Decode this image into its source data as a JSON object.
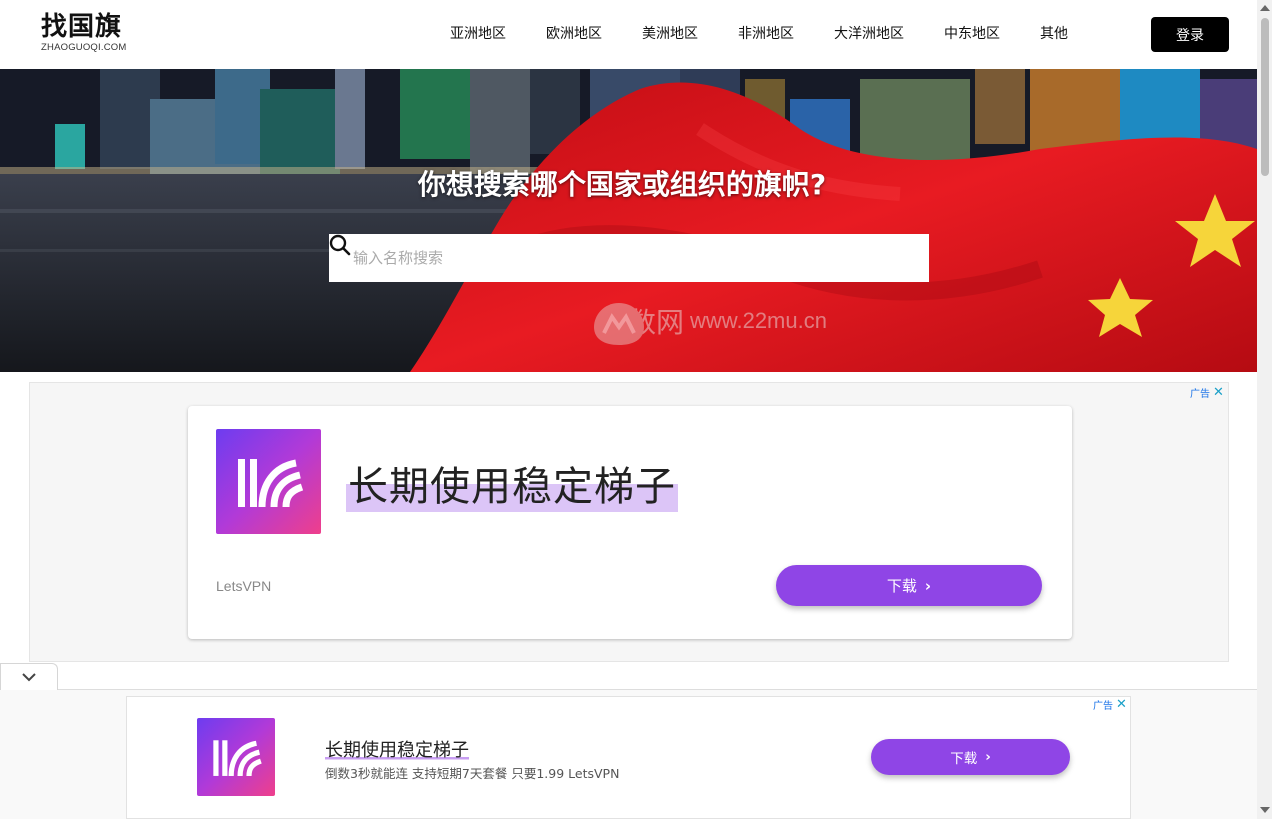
{
  "header": {
    "logo_main": "找国旗",
    "logo_sub": "ZHAOGUOQI.COM",
    "nav": [
      "亚洲地区",
      "欧洲地区",
      "美洲地区",
      "非洲地区",
      "大洋洲地区",
      "中东地区",
      "其他"
    ],
    "login_label": "登录"
  },
  "hero": {
    "title": "你想搜索哪个国家或组织的旗帜?",
    "search_placeholder": "输入名称搜索",
    "search_icon": "search-icon",
    "watermark_text": "慕数网",
    "watermark_url": "www.22mu.cn"
  },
  "ad1": {
    "ad_label": "广告",
    "close_symbol": "✕",
    "headline": "长期使用稳定梯子",
    "brand": "LetsVPN",
    "button_label": "下载",
    "button_chevron": "›"
  },
  "ad2": {
    "ad_label": "广告",
    "close_symbol": "✕",
    "headline": "长期使用稳定梯子",
    "description": "倒数3秒就能连 支持短期7天套餐 只要1.99 LetsVPN",
    "button_label": "下载",
    "button_chevron": "›"
  },
  "colors": {
    "accent_purple": "#8f45e6",
    "flag_red": "#e0141c",
    "flag_star": "#f6d53a",
    "header_button": "#000000"
  }
}
